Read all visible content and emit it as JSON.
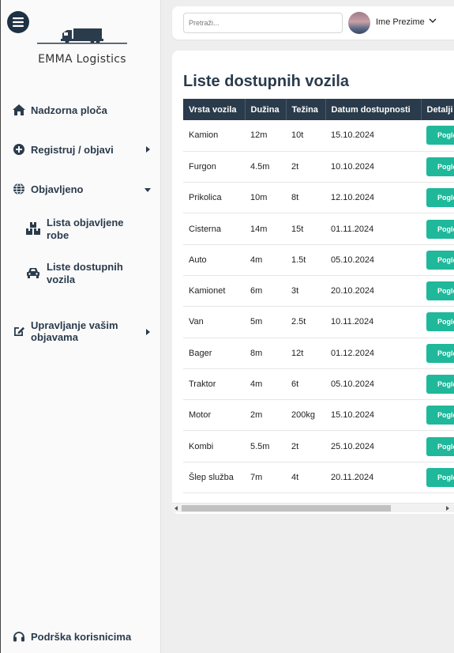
{
  "brand": {
    "name": "EMMA Logistics"
  },
  "search": {
    "placeholder": "Pretraži..."
  },
  "user": {
    "name": "Ime Prezime"
  },
  "sidebar": {
    "items": [
      {
        "label": "Nadzorna ploča",
        "icon": "home-icon"
      },
      {
        "label": "Registruj / objavi",
        "icon": "plus-circle-icon"
      },
      {
        "label": "Objavljeno",
        "icon": "globe-icon"
      },
      {
        "label": "Upravljanje vašim objavama",
        "icon": "edit-icon"
      }
    ],
    "subitems": [
      {
        "label": "Lista objavljene robe",
        "icon": "boxes-icon"
      },
      {
        "label": "Liste dostupnih vozila",
        "icon": "car-icon"
      }
    ],
    "support": {
      "label": "Podrška korisnicima",
      "icon": "headset-icon"
    }
  },
  "main": {
    "title": "Liste dostupnih vozila",
    "columns": [
      "Vrsta vozila",
      "Dužina",
      "Težina",
      "Datum dostupnosti",
      "Detalji"
    ],
    "button_label": "Pogledaj",
    "rows": [
      {
        "type": "Kamion",
        "length": "12m",
        "weight": "10t",
        "date": "15.10.2024"
      },
      {
        "type": "Furgon",
        "length": "4.5m",
        "weight": "2t",
        "date": "10.10.2024"
      },
      {
        "type": "Prikolica",
        "length": "10m",
        "weight": "8t",
        "date": "12.10.2024"
      },
      {
        "type": "Cisterna",
        "length": "14m",
        "weight": "15t",
        "date": "01.11.2024"
      },
      {
        "type": "Auto",
        "length": "4m",
        "weight": "1.5t",
        "date": "05.10.2024"
      },
      {
        "type": "Kamionet",
        "length": "6m",
        "weight": "3t",
        "date": "20.10.2024"
      },
      {
        "type": "Van",
        "length": "5m",
        "weight": "2.5t",
        "date": "10.11.2024"
      },
      {
        "type": "Bager",
        "length": "8m",
        "weight": "12t",
        "date": "01.12.2024"
      },
      {
        "type": "Traktor",
        "length": "4m",
        "weight": "6t",
        "date": "05.10.2024"
      },
      {
        "type": "Motor",
        "length": "2m",
        "weight": "200kg",
        "date": "15.10.2024"
      },
      {
        "type": "Kombi",
        "length": "5.5m",
        "weight": "2t",
        "date": "25.10.2024"
      },
      {
        "type": "Šlep služba",
        "length": "7m",
        "weight": "4t",
        "date": "20.11.2024"
      }
    ]
  }
}
